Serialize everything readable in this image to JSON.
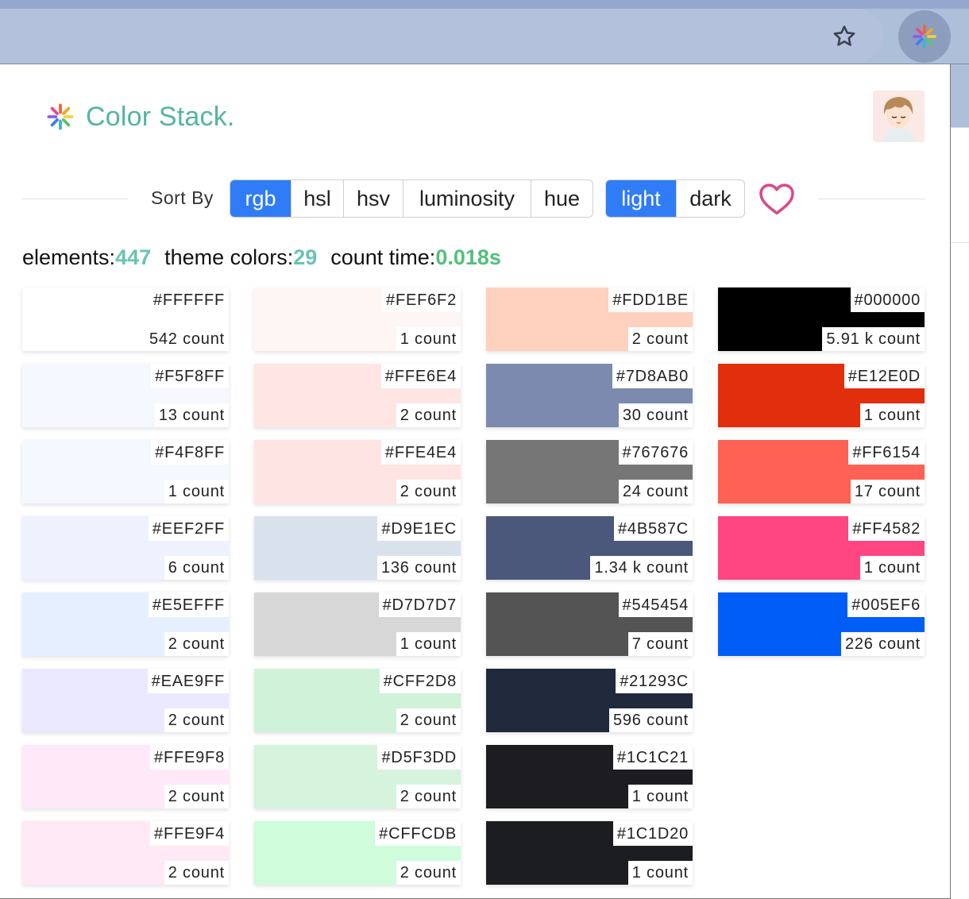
{
  "header": {
    "title": "Color Stack."
  },
  "controls": {
    "sort_label": "Sort By",
    "sort_options": [
      "rgb",
      "hsl",
      "hsv",
      "luminosity",
      "hue"
    ],
    "sort_active": "rgb",
    "theme_options": [
      "light",
      "dark"
    ],
    "theme_active": "light"
  },
  "stats": {
    "elements_label": "elements:",
    "elements_value": "447",
    "theme_colors_label": "theme colors:",
    "theme_colors_value": "29",
    "count_time_label": "count time:",
    "count_time_value": "0.018s"
  },
  "columns": [
    [
      {
        "hex": "#FFFFFF",
        "count": "542 count"
      },
      {
        "hex": "#F5F8FF",
        "count": "13 count"
      },
      {
        "hex": "#F4F8FF",
        "count": "1 count"
      },
      {
        "hex": "#EEF2FF",
        "count": "6 count"
      },
      {
        "hex": "#E5EFFF",
        "count": "2 count"
      },
      {
        "hex": "#EAE9FF",
        "count": "2 count"
      },
      {
        "hex": "#FFE9F8",
        "count": "2 count"
      },
      {
        "hex": "#FFE9F4",
        "count": "2 count"
      }
    ],
    [
      {
        "hex": "#FEF6F2",
        "count": "1 count"
      },
      {
        "hex": "#FFE6E4",
        "count": "2 count"
      },
      {
        "hex": "#FFE4E4",
        "count": "2 count"
      },
      {
        "hex": "#D9E1EC",
        "count": "136 count"
      },
      {
        "hex": "#D7D7D7",
        "count": "1 count"
      },
      {
        "hex": "#CFF2D8",
        "count": "2 count"
      },
      {
        "hex": "#D5F3DD",
        "count": "2 count"
      },
      {
        "hex": "#CFFCDB",
        "count": "2 count"
      }
    ],
    [
      {
        "hex": "#FDD1BE",
        "count": "2 count"
      },
      {
        "hex": "#7D8AB0",
        "count": "30 count"
      },
      {
        "hex": "#767676",
        "count": "24 count"
      },
      {
        "hex": "#4B587C",
        "count": "1.34 k count"
      },
      {
        "hex": "#545454",
        "count": "7 count"
      },
      {
        "hex": "#21293C",
        "count": "596 count"
      },
      {
        "hex": "#1C1C21",
        "count": "1 count"
      },
      {
        "hex": "#1C1D20",
        "count": "1 count"
      }
    ],
    [
      {
        "hex": "#000000",
        "count": "5.91 k count"
      },
      {
        "hex": "#E12E0D",
        "count": "1 count"
      },
      {
        "hex": "#FF6154",
        "count": "17 count"
      },
      {
        "hex": "#FF4582",
        "count": "1 count"
      },
      {
        "hex": "#005EF6",
        "count": "226 count"
      }
    ]
  ],
  "colors": {
    "brand": "#53b5a1",
    "accent_blue": "#2f7cf6",
    "heart": "#d94a8c"
  },
  "icons": {
    "bookmark": "star-outline-icon",
    "extension": "color-stack-pinwheel-icon",
    "favorite": "heart-outline-icon"
  }
}
